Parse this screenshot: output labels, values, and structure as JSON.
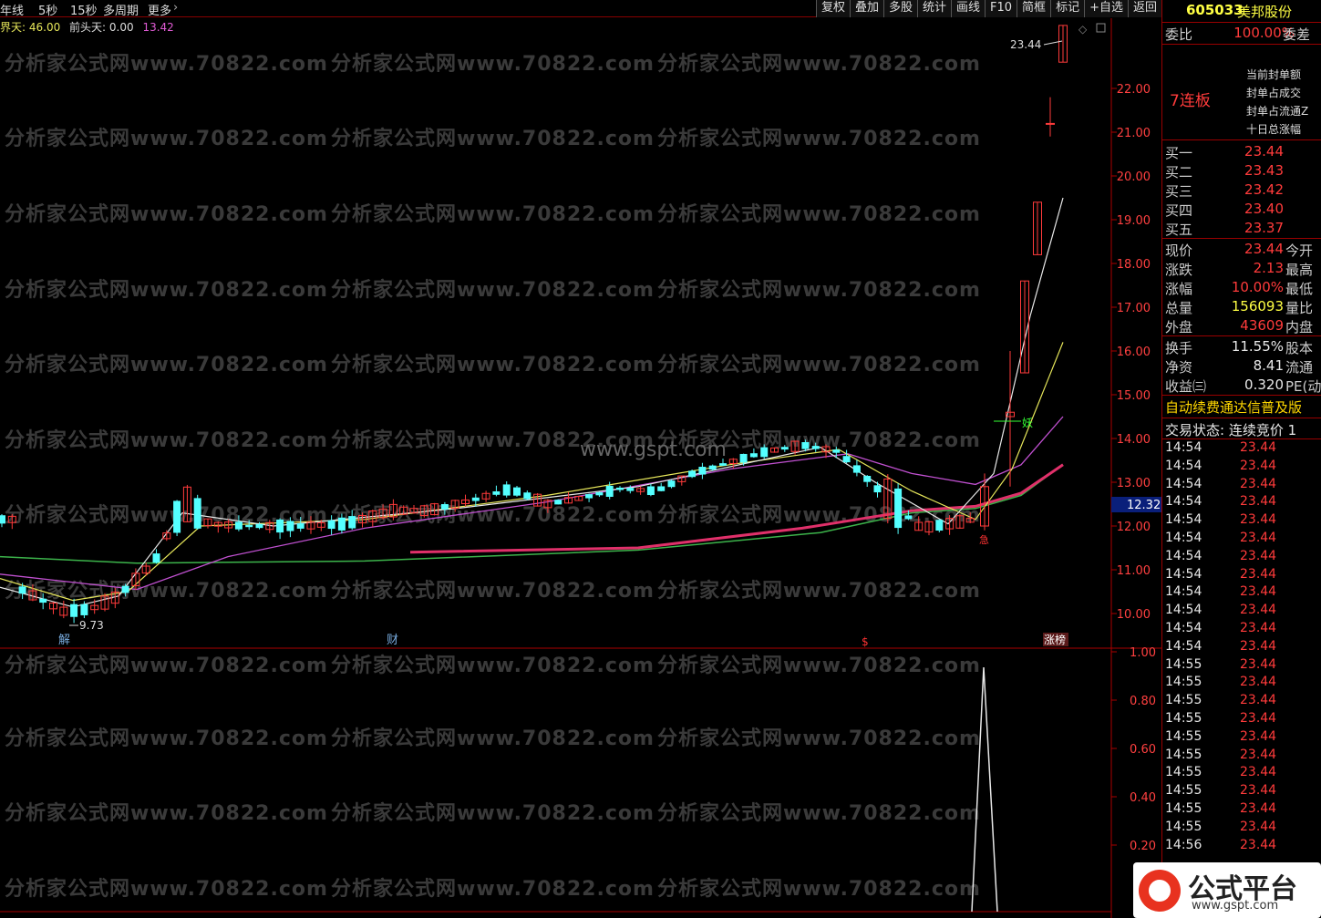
{
  "toolbar": {
    "period_tabs": [
      "年线",
      "5秒",
      "15秒",
      "多周期",
      "更多"
    ],
    "buttons": [
      "复权",
      "叠加",
      "多股",
      "统计",
      "画线",
      "F10",
      "简框",
      "标记",
      "+自选",
      "返回"
    ]
  },
  "indicator_bar": {
    "item1": "界天: 46.00",
    "item2": "前头天: 0.00",
    "item3": "13.42"
  },
  "price_axis": [
    "22.00",
    "21.00",
    "20.00",
    "19.00",
    "18.00",
    "17.00",
    "16.00",
    "15.00",
    "14.00",
    "13.00",
    "12.00",
    "11.00",
    "10.00"
  ],
  "price_tag": "12.32",
  "volume_axis": [
    "1.00",
    "0.80",
    "0.60",
    "0.40",
    "0.20"
  ],
  "annotations": {
    "high_label": "23.44",
    "low_label": "9.73",
    "event_1": "解",
    "event_2": "财",
    "event_3": "$",
    "event_4": "涨榜",
    "jump_label": "妖",
    "mark": "急"
  },
  "watermark": "分析家公式网www.70822.com",
  "center_watermark": "www.gspt.com",
  "quote": {
    "code": "605033",
    "name": "美邦股份",
    "weibi_label": "委比",
    "weibi_value": "100.00%",
    "weicha_label": "委差",
    "limit_label": "7连板",
    "limit_lines": [
      "当前封单额",
      "封单占成交",
      "封单占流通Z",
      "十日总涨幅"
    ],
    "bids": [
      {
        "label": "买一",
        "price": "23.44"
      },
      {
        "label": "买二",
        "price": "23.43"
      },
      {
        "label": "买三",
        "price": "23.42"
      },
      {
        "label": "买四",
        "price": "23.40"
      },
      {
        "label": "买五",
        "price": "23.37"
      }
    ],
    "stats1": [
      {
        "label": "现价",
        "value": "23.44",
        "tail": "今开"
      },
      {
        "label": "涨跌",
        "value": "2.13",
        "tail": "最高"
      },
      {
        "label": "涨幅",
        "value": "10.00%",
        "tail": "最低"
      },
      {
        "label": "总量",
        "value": "156093",
        "tail": "量比"
      },
      {
        "label": "外盘",
        "value": "43609",
        "tail": "内盘"
      }
    ],
    "stats2": [
      {
        "label": "换手",
        "value": "11.55%",
        "tail": "股本"
      },
      {
        "label": "净资",
        "value": "8.41",
        "tail": "流通"
      },
      {
        "label": "收益㈢",
        "value": "0.320",
        "tail": "PE(动"
      }
    ],
    "ad_text": "自动续费通达信普及版",
    "trade_status": "交易状态: 连续竞价 1"
  },
  "ticks": [
    {
      "time": "14:54",
      "price": "23.44"
    },
    {
      "time": "14:54",
      "price": "23.44"
    },
    {
      "time": "14:54",
      "price": "23.44"
    },
    {
      "time": "14:54",
      "price": "23.44"
    },
    {
      "time": "14:54",
      "price": "23.44"
    },
    {
      "time": "14:54",
      "price": "23.44"
    },
    {
      "time": "14:54",
      "price": "23.44"
    },
    {
      "time": "14:54",
      "price": "23.44"
    },
    {
      "time": "14:54",
      "price": "23.44"
    },
    {
      "time": "14:54",
      "price": "23.44"
    },
    {
      "time": "14:54",
      "price": "23.44"
    },
    {
      "time": "14:54",
      "price": "23.44"
    },
    {
      "time": "14:55",
      "price": "23.44"
    },
    {
      "time": "14:55",
      "price": "23.44"
    },
    {
      "time": "14:55",
      "price": "23.44"
    },
    {
      "time": "14:55",
      "price": "23.44"
    },
    {
      "time": "14:55",
      "price": "23.44"
    },
    {
      "time": "14:55",
      "price": "23.44"
    },
    {
      "time": "14:55",
      "price": "23.44"
    },
    {
      "time": "14:55",
      "price": "23.44"
    },
    {
      "time": "14:55",
      "price": "23.44"
    },
    {
      "time": "14:55",
      "price": "23.44"
    },
    {
      "time": "14:56",
      "price": "23.44"
    }
  ],
  "logo": {
    "title": "公式平台",
    "url": "www.gspt.com"
  },
  "colors": {
    "up": "#ff3b3b",
    "down": "#54ffff",
    "ma_white": "#e8e8e8",
    "ma_yellow": "#e6e65a",
    "ma_purple": "#c050d0",
    "ma_green": "#3cb44b",
    "grid": "#8b0000"
  }
}
